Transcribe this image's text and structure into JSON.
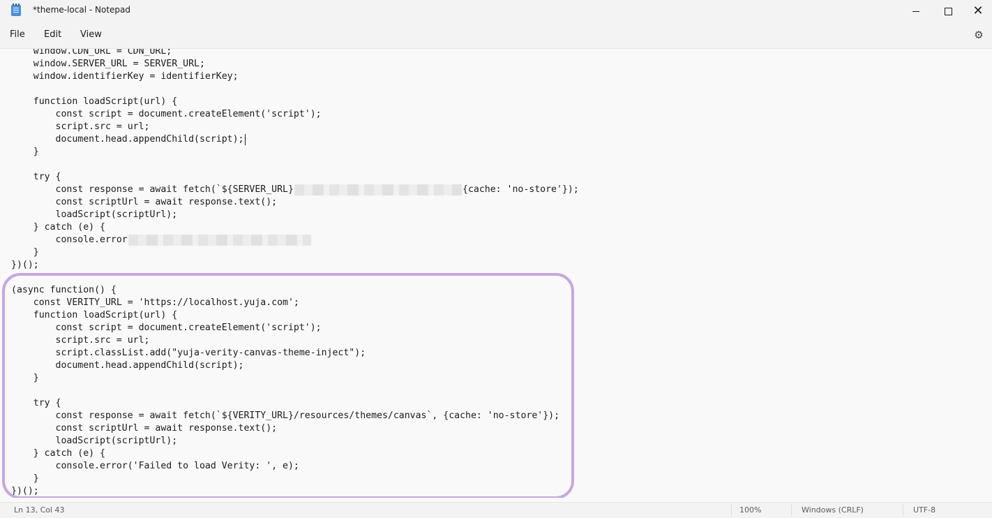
{
  "window": {
    "title": "*theme-local - Notepad",
    "icon": "notepad-icon",
    "controls": {
      "minimize": "minimize-icon",
      "maximize": "maximize-icon",
      "close": "close-icon"
    }
  },
  "menu": {
    "file": "File",
    "edit": "Edit",
    "view": "View",
    "settings_icon": "gear-icon"
  },
  "editor": {
    "lines": [
      "    window.CDN_URL = CDN_URL;",
      "    window.SERVER_URL = SERVER_URL;",
      "    window.identifierKey = identifierKey;",
      "",
      "    function loadScript(url) {",
      "        const script = document.createElement('script');",
      "        script.src = url;",
      "        document.head.appendChild(script);",
      "    }",
      "",
      "    try {",
      "        const response = await fetch(`${SERVER_URL}",
      "        const scriptUrl = await response.text();",
      "        loadScript(scriptUrl);",
      "    } catch (e) {",
      "        console.error",
      "    }",
      "})();",
      "",
      "(async function() {",
      "    const VERITY_URL = 'https://localhost.yuja.com';",
      "    function loadScript(url) {",
      "        const script = document.createElement('script');",
      "        script.src = url;",
      "        script.classList.add(\"yuja-verity-canvas-theme-inject\");",
      "        document.head.appendChild(script);",
      "    }",
      "",
      "    try {",
      "        const response = await fetch(`${VERITY_URL}/resources/themes/canvas`, {cache: 'no-store'});",
      "        const scriptUrl = await response.text();",
      "        loadScript(scriptUrl);",
      "    } catch (e) {",
      "        console.error('Failed to load Verity: ', e);",
      "    }",
      "})();"
    ],
    "line11_suffix": "{cache: 'no-store'});"
  },
  "status": {
    "position": "Ln 13, Col 43",
    "zoom": "100%",
    "line_ending": "Windows (CRLF)",
    "encoding": "UTF-8"
  },
  "colors": {
    "highlight": "#c8a6e0",
    "background": "#f9f9f9",
    "chrome": "#f3f3f3"
  }
}
